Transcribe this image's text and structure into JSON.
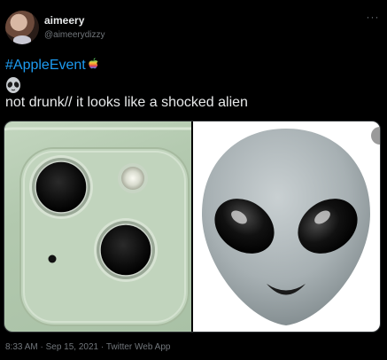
{
  "author": {
    "display_name": "aimeery",
    "handle": "@aimeerydizzy"
  },
  "more_icon": "more-horizontal-icon",
  "tweet": {
    "hashtag": "#AppleEvent",
    "hashtag_icon": "apple-logo-rainbow",
    "emoji": "alien-emoji",
    "text": "not drunk// it looks like a shocked alien"
  },
  "media": {
    "left_photo": "iphone-camera-bump-photo",
    "right_photo": "alien-memoji-photo"
  },
  "meta": {
    "time": "8:33 AM",
    "separator": " · ",
    "date": "Sep 15, 2021",
    "source": "Twitter Web App"
  },
  "colors": {
    "background": "#000000",
    "text": "#e7e9ea",
    "secondary": "#71767b",
    "link": "#1d9bf0",
    "phone_green": "#b8ceb4"
  }
}
